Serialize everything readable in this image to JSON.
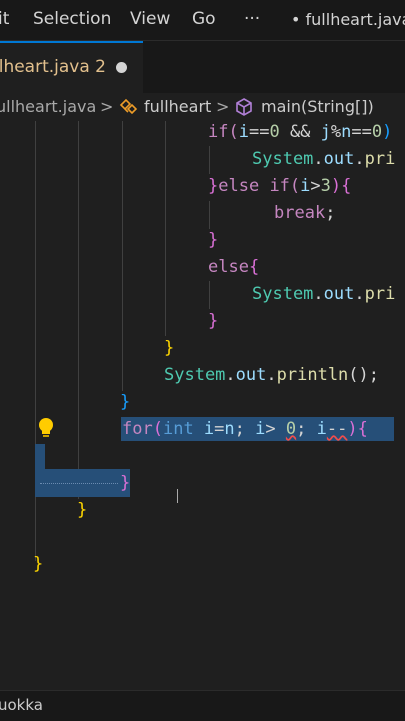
{
  "menu": {
    "edit": "it",
    "selection": "Selection",
    "view": "View",
    "go": "Go",
    "more": "···",
    "window_title": "• fullheart.java"
  },
  "tab": {
    "label": "llheart.java 2"
  },
  "breadcrumb": {
    "file": "ullheart.java",
    "sep1": ">",
    "class": "fullheart",
    "sep2": ">",
    "method": "main(String[])"
  },
  "code": {
    "l1_a": "if(",
    "l1_b": "i",
    "l1_c": "==",
    "l1_d": "0",
    "l1_e": " && ",
    "l1_f": "j",
    "l1_g": "%",
    "l1_h": "n",
    "l1_i": "==",
    "l1_j": "0",
    "l1_k": ")",
    "l2_a": "System",
    "l2_b": ".",
    "l2_c": "out",
    "l2_d": ".",
    "l2_e": "pri",
    "l3_a": "}",
    "l3_b": "else ",
    "l3_c": "if(",
    "l3_d": "i",
    "l3_e": ">",
    "l3_f": "3",
    "l3_g": "){",
    "l4_a": "break",
    "l4_b": ";",
    "l5_a": "}",
    "l6_a": "else",
    "l6_b": "{",
    "l7_a": "System",
    "l7_b": ".",
    "l7_c": "out",
    "l7_d": ".",
    "l7_e": "pri",
    "l8_a": "}",
    "l9_a": "}",
    "l10_a": "System",
    "l10_b": ".",
    "l10_c": "out",
    "l10_d": ".",
    "l10_e": "println",
    "l10_f": "();",
    "l11_a": "}",
    "l12_a": "for",
    "l12_b": "(",
    "l12_c": "int ",
    "l12_d": "i",
    "l12_e": "=",
    "l12_f": "n",
    "l12_g": "; ",
    "l12_h": "i",
    "l12_i": "> ",
    "l12_j": "0",
    "l12_k": "; ",
    "l12_l": "i",
    "l12_m": "--",
    "l12_n": "){",
    "l13_a": "}",
    "l14_a": "}",
    "l15_a": "}"
  },
  "status": {
    "left": "uokka"
  },
  "colors": {
    "accent": "#0078d4",
    "selection": "#264f78",
    "background": "#1f1f1f"
  },
  "icons": {
    "lightbulb": "lightbulb-icon",
    "class": "class-icon",
    "method": "method-icon"
  }
}
